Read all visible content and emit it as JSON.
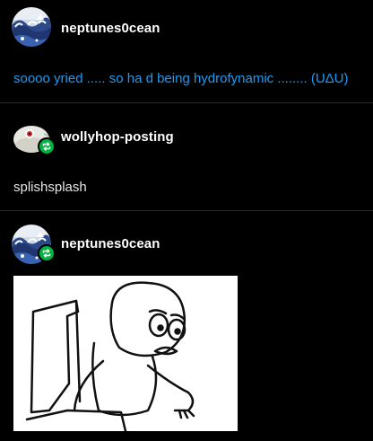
{
  "posts": [
    {
      "username": "neptunes0cean",
      "avatar": "wave-art-avatar",
      "reblogged": false,
      "text": "soooo yried ..... so ha d being hydrofynamic ........ (UΔU)",
      "text_color": "#1d9bf0"
    },
    {
      "username": "wollyhop-posting",
      "avatar": "fish-creature-avatar",
      "reblogged": true,
      "text": "splishsplash",
      "text_color": "#e7e7e7"
    },
    {
      "username": "neptunes0cean",
      "avatar": "wave-art-avatar",
      "reblogged": true,
      "image": "worried-sketch-drawing"
    }
  ],
  "colors": {
    "background": "#000000",
    "reblog_badge": "#00b341",
    "link_text": "#1d9bf0",
    "divider": "#2a2a2a"
  },
  "icons": {
    "reblog": "reblog-icon"
  }
}
